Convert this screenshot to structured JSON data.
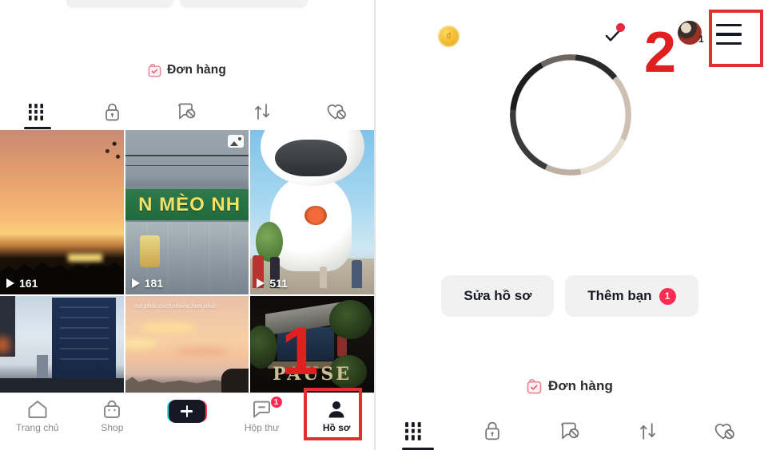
{
  "left_panel": {
    "order_link": {
      "label": "Đơn hàng",
      "icon": "shopping-bag-check-icon"
    },
    "content_tabs": [
      {
        "name": "grid-tab",
        "icon": "grid-bars-icon",
        "active": true
      },
      {
        "name": "private-tab",
        "icon": "lock-icon",
        "active": false
      },
      {
        "name": "tagged-tab",
        "icon": "tagged-hidden-icon",
        "active": false
      },
      {
        "name": "reposts-tab",
        "icon": "repost-arrows-icon",
        "active": false
      },
      {
        "name": "liked-tab",
        "icon": "heart-hidden-icon",
        "active": false
      }
    ],
    "videos": [
      {
        "id": "video-1",
        "play_count": "161",
        "is_photo": false,
        "art": "art-sunset1",
        "caption": ""
      },
      {
        "id": "video-2",
        "play_count": "181",
        "is_photo": true,
        "art": "art-shop",
        "caption": "N MÈO NH"
      },
      {
        "id": "video-3",
        "play_count": "511",
        "is_photo": false,
        "art": "art-balloon",
        "caption": ""
      },
      {
        "id": "video-4",
        "play_count": "",
        "is_photo": false,
        "art": "art-building",
        "caption": ""
      },
      {
        "id": "video-5",
        "play_count": "",
        "is_photo": false,
        "art": "art-sunset2",
        "caption": "tại phải\ncách nhiều hơn nhất"
      },
      {
        "id": "video-6",
        "play_count": "",
        "is_photo": false,
        "art": "art-cafe",
        "caption": "PAUSE"
      }
    ],
    "bottom_nav": [
      {
        "name": "nav-home",
        "label": "Trang chủ",
        "icon": "home-icon",
        "badge": "",
        "active": false
      },
      {
        "name": "nav-shop",
        "label": "Shop",
        "icon": "bag-icon",
        "badge": "",
        "active": false
      },
      {
        "name": "nav-create",
        "label": "",
        "icon": "plus-icon",
        "badge": "",
        "active": false
      },
      {
        "name": "nav-inbox",
        "label": "Hộp thư",
        "icon": "message-icon",
        "badge": "1",
        "active": false
      },
      {
        "name": "nav-profile",
        "label": "Hồ sơ",
        "icon": "person-icon",
        "badge": "",
        "active": true
      }
    ]
  },
  "right_panel": {
    "header": {
      "coin_icon": "gold-coin-icon",
      "check_icon": "checkmark-icon",
      "check_has_dot": true,
      "avatar_icon": "user-avatar-icon",
      "avatar_count": "1",
      "menu_icon": "hamburger-menu-icon"
    },
    "profile": {
      "avatar_icon": "profile-avatar-ring"
    },
    "actions": [
      {
        "name": "edit-profile-button",
        "label": "Sửa hồ sơ",
        "badge": ""
      },
      {
        "name": "add-friend-button",
        "label": "Thêm bạn",
        "badge": "1"
      }
    ],
    "order_link": {
      "label": "Đơn hàng",
      "icon": "shopping-bag-check-icon"
    },
    "content_tabs": [
      {
        "name": "grid-tab",
        "icon": "grid-bars-icon",
        "active": true
      },
      {
        "name": "private-tab",
        "icon": "lock-icon",
        "active": false
      },
      {
        "name": "tagged-tab",
        "icon": "tagged-hidden-icon",
        "active": false
      },
      {
        "name": "reposts-tab",
        "icon": "repost-arrows-icon",
        "active": false
      },
      {
        "name": "liked-tab",
        "icon": "heart-hidden-icon",
        "active": false
      }
    ]
  },
  "annotations": [
    {
      "name": "annotation-step-1",
      "number": "1",
      "target": "nav-profile"
    },
    {
      "name": "annotation-step-2",
      "number": "2",
      "target": "hamburger-menu-icon"
    }
  ],
  "colors": {
    "accent_red": "#fe2c55",
    "annotation_red": "#e02020",
    "dark": "#161823",
    "muted": "#8a8a8e",
    "pill_bg": "#f1f1f2"
  }
}
